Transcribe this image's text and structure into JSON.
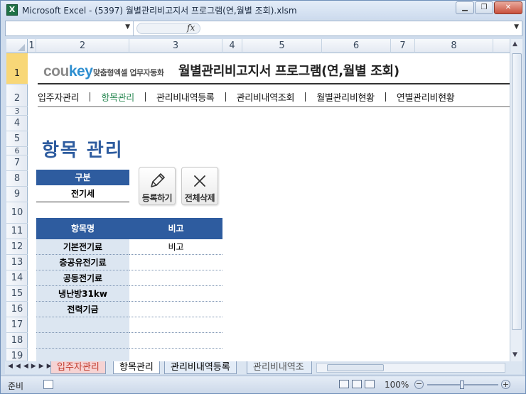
{
  "window": {
    "title": "Microsoft Excel - (5397) 월별관리비고지서 프로그램(연,월별 조회).xlsm",
    "app_icon": "X"
  },
  "formula_bar": {
    "fx": "fx"
  },
  "columns": [
    "1",
    "2",
    "3",
    "4",
    "5",
    "6",
    "7",
    "8"
  ],
  "rows": [
    "1",
    "2",
    "3",
    "4",
    "5",
    "6",
    "7",
    "8",
    "9",
    "10",
    "11",
    "12",
    "13",
    "14",
    "15",
    "16",
    "17",
    "18",
    "19"
  ],
  "header": {
    "logo_cou": "cou",
    "logo_key": "key",
    "logo_tag": "맞춤형엑셀 업무자동화",
    "title": "월별관리비고지서 프로그램(연,월별 조회)"
  },
  "nav": {
    "items": [
      "입주자관리",
      "항목관리",
      "관리비내역등록",
      "관리비내역조회",
      "월별관리비현황",
      "연별관리비현황"
    ],
    "active": "항목관리"
  },
  "page_heading": "항목 관리",
  "category": {
    "label": "구분",
    "value": "전기세"
  },
  "buttons": {
    "register": "등록하기",
    "delete_all": "전체삭제"
  },
  "table": {
    "headers": [
      "항목명",
      "비고"
    ],
    "rows": [
      [
        "기본전기료",
        "비고"
      ],
      [
        "층공유전기료",
        ""
      ],
      [
        "공동전기료",
        ""
      ],
      [
        "냉난방31kw",
        ""
      ],
      [
        "전력기금",
        ""
      ],
      [
        "",
        ""
      ],
      [
        "",
        ""
      ],
      [
        "",
        ""
      ]
    ]
  },
  "sheet_tabs": [
    "입주자관리",
    "항목관리",
    "관리비내역등록",
    "관리비내역조"
  ],
  "active_sheet": "항목관리",
  "status": {
    "ready": "준비",
    "zoom": "100%"
  },
  "colors": {
    "accent": "#2e5c9f",
    "active_nav": "#2e8b57",
    "table_label_bg": "#dce6f1",
    "selected_row": "#f8d777"
  }
}
